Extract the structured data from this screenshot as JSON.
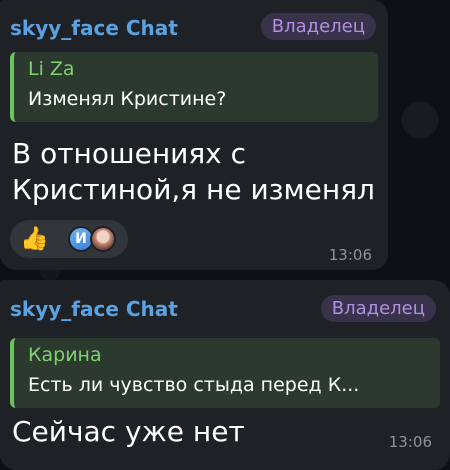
{
  "messages": [
    {
      "sender": "skyy_face Chat",
      "role_badge": "Владелец",
      "reply": {
        "author": "Li Za",
        "text": "Изменял Кристине?"
      },
      "text": "В отношениях с Кристиной,я не изменял",
      "reactions": {
        "emoji": "👍",
        "emoji_icon": "thumbs-up-icon",
        "reactor_initial": "И"
      },
      "time": "13:06"
    },
    {
      "sender": "skyy_face Chat",
      "role_badge": "Владелец",
      "reply": {
        "author": "Карина",
        "text": "Есть ли чувство стыда перед К..."
      },
      "text": "Сейчас уже нет",
      "time": "13:06"
    }
  ],
  "colors": {
    "background": "#0c1013",
    "bubble": "#1e2226",
    "sender": "#5aa2e2",
    "role_badge": "#b48ee0",
    "quote_bar": "#6ac35d",
    "quote_author": "#7ed36d",
    "time": "#8b949b"
  }
}
